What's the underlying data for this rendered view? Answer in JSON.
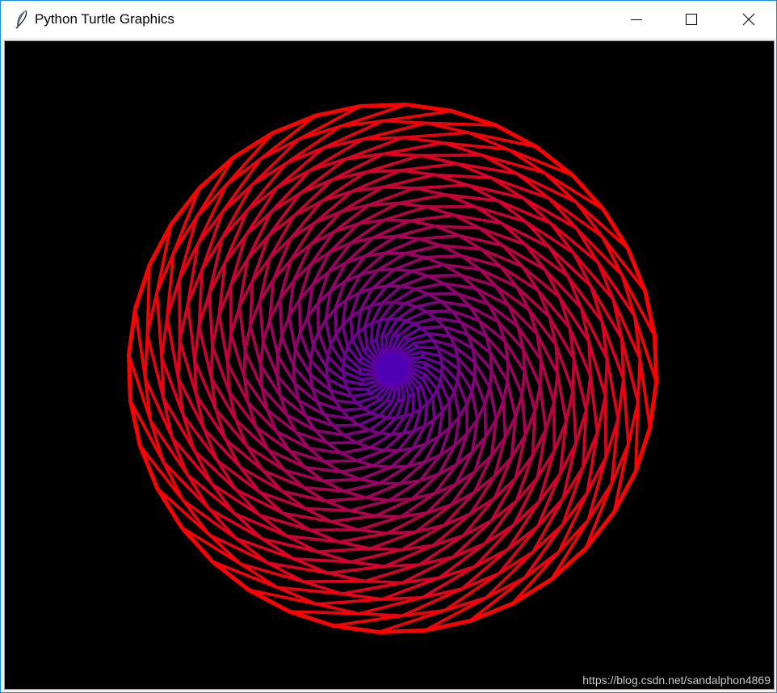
{
  "window": {
    "title": "Python Turtle Graphics"
  },
  "icons": {
    "app": "feather-icon",
    "minimize": "minimize-icon",
    "maximize": "maximize-icon",
    "close": "close-icon"
  },
  "canvas": {
    "background": "#000000",
    "drawing": {
      "type": "spiral rosette",
      "arm_count": 36,
      "ring_count": 16,
      "outer_color": "#ff0000",
      "inner_color": "#5000b4"
    }
  },
  "watermark": "https://blog.csdn.net/sandalphon4869"
}
